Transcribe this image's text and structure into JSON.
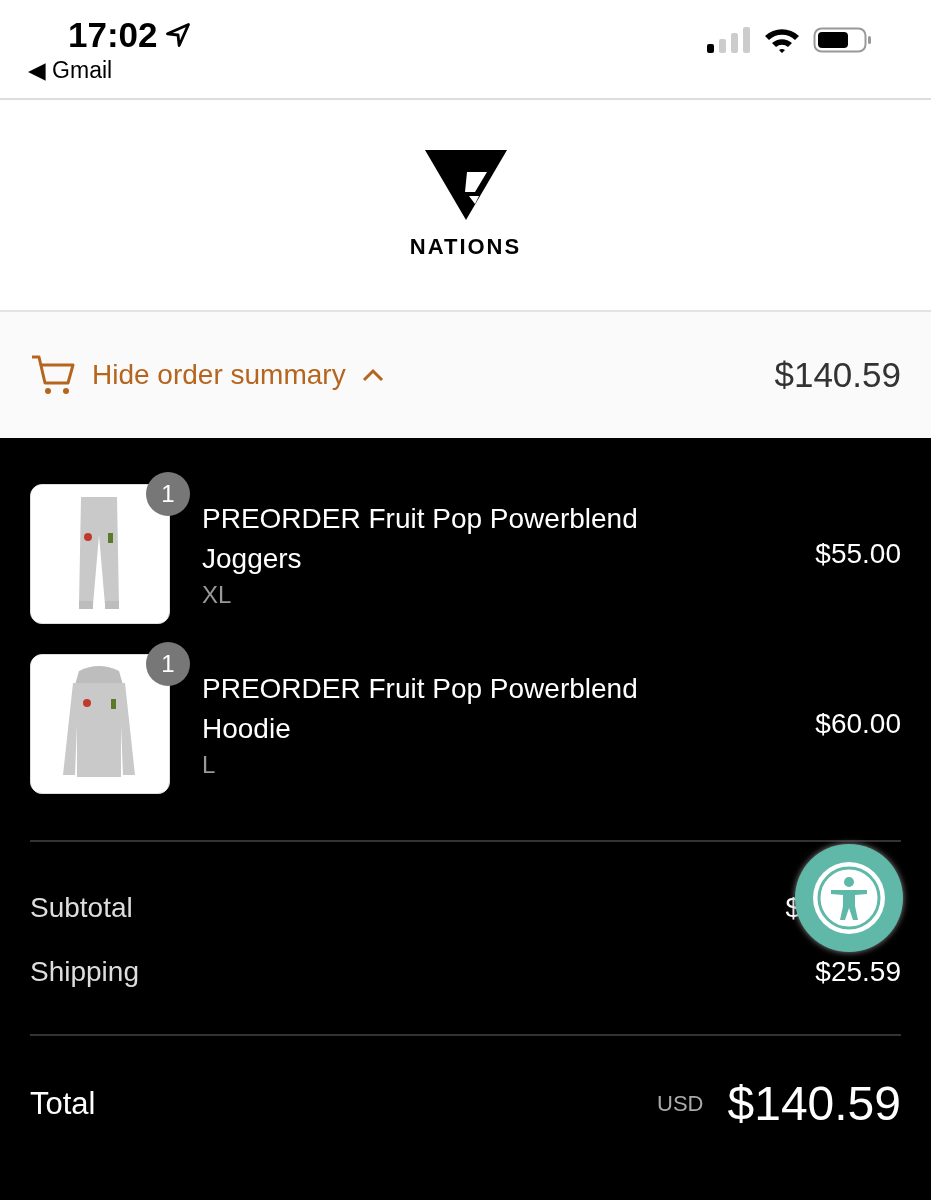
{
  "status_bar": {
    "time": "17:02",
    "back_app": "◀ Gmail"
  },
  "header": {
    "brand": "NATIONS"
  },
  "summary_toggle": {
    "label": "Hide order summary",
    "expanded": true,
    "total": "$140.59"
  },
  "items": [
    {
      "quantity": "1",
      "name": "PREORDER Fruit Pop Powerblend Joggers",
      "variant": "XL",
      "price": "$55.00",
      "kind": "joggers"
    },
    {
      "quantity": "1",
      "name": "PREORDER Fruit Pop Powerblend Hoodie",
      "variant": "L",
      "price": "$60.00",
      "kind": "hoodie"
    }
  ],
  "costs": [
    {
      "label": "Subtotal",
      "value": "$"
    },
    {
      "label": "Shipping",
      "value": "$25.59"
    }
  ],
  "total": {
    "label": "Total",
    "currency": "USD",
    "amount": "$140.59"
  }
}
